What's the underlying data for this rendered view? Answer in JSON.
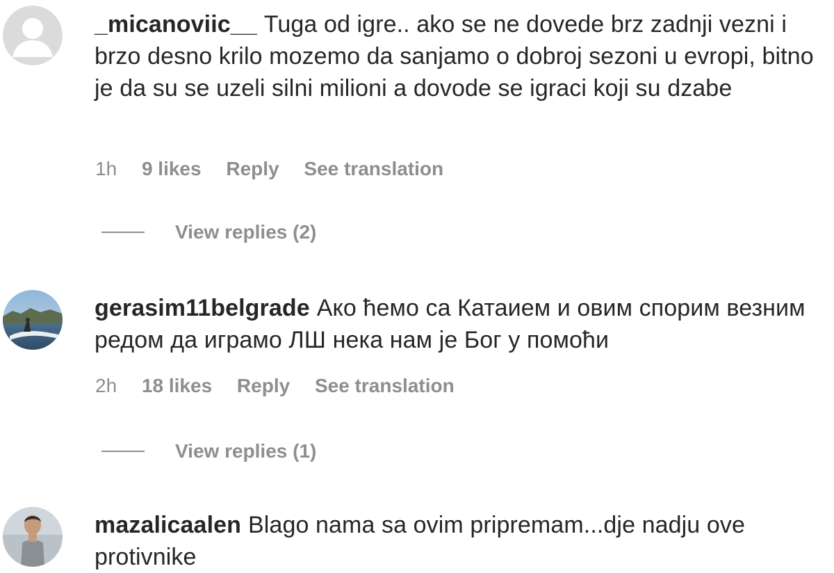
{
  "comments": [
    {
      "username": "_micanoviic__",
      "text": "Tuga od igre.. ako se ne dovede brz zadnji vezni i brzo desno krilo mozemo da sanjamo o dobroj sezoni u evropi, bitno je da su se uzeli silni milioni a dovode se igraci koji su dzabe",
      "time": "1h",
      "likes": "9 likes",
      "reply": "Reply",
      "translate": "See translation",
      "view_replies": "View replies (2)",
      "avatar": "default-avatar-icon"
    },
    {
      "username": "gerasim11belgrade",
      "text": "Ако ћемо са Катаием и овим спорим везним редом да играмо ЛШ нека нам је Бог у помоћи",
      "time": "2h",
      "likes": "18 likes",
      "reply": "Reply",
      "translate": "See translation",
      "view_replies": "View replies (1)",
      "avatar": "photo-avatar-surfing"
    },
    {
      "username": "mazalicaalen",
      "text": "Blago nama sa ovim pripremam...dje nadju ove protivnike",
      "avatar": "photo-avatar-person"
    }
  ],
  "colors": {
    "text": "#262626",
    "muted": "#8e8e8e",
    "background": "#ffffff"
  }
}
